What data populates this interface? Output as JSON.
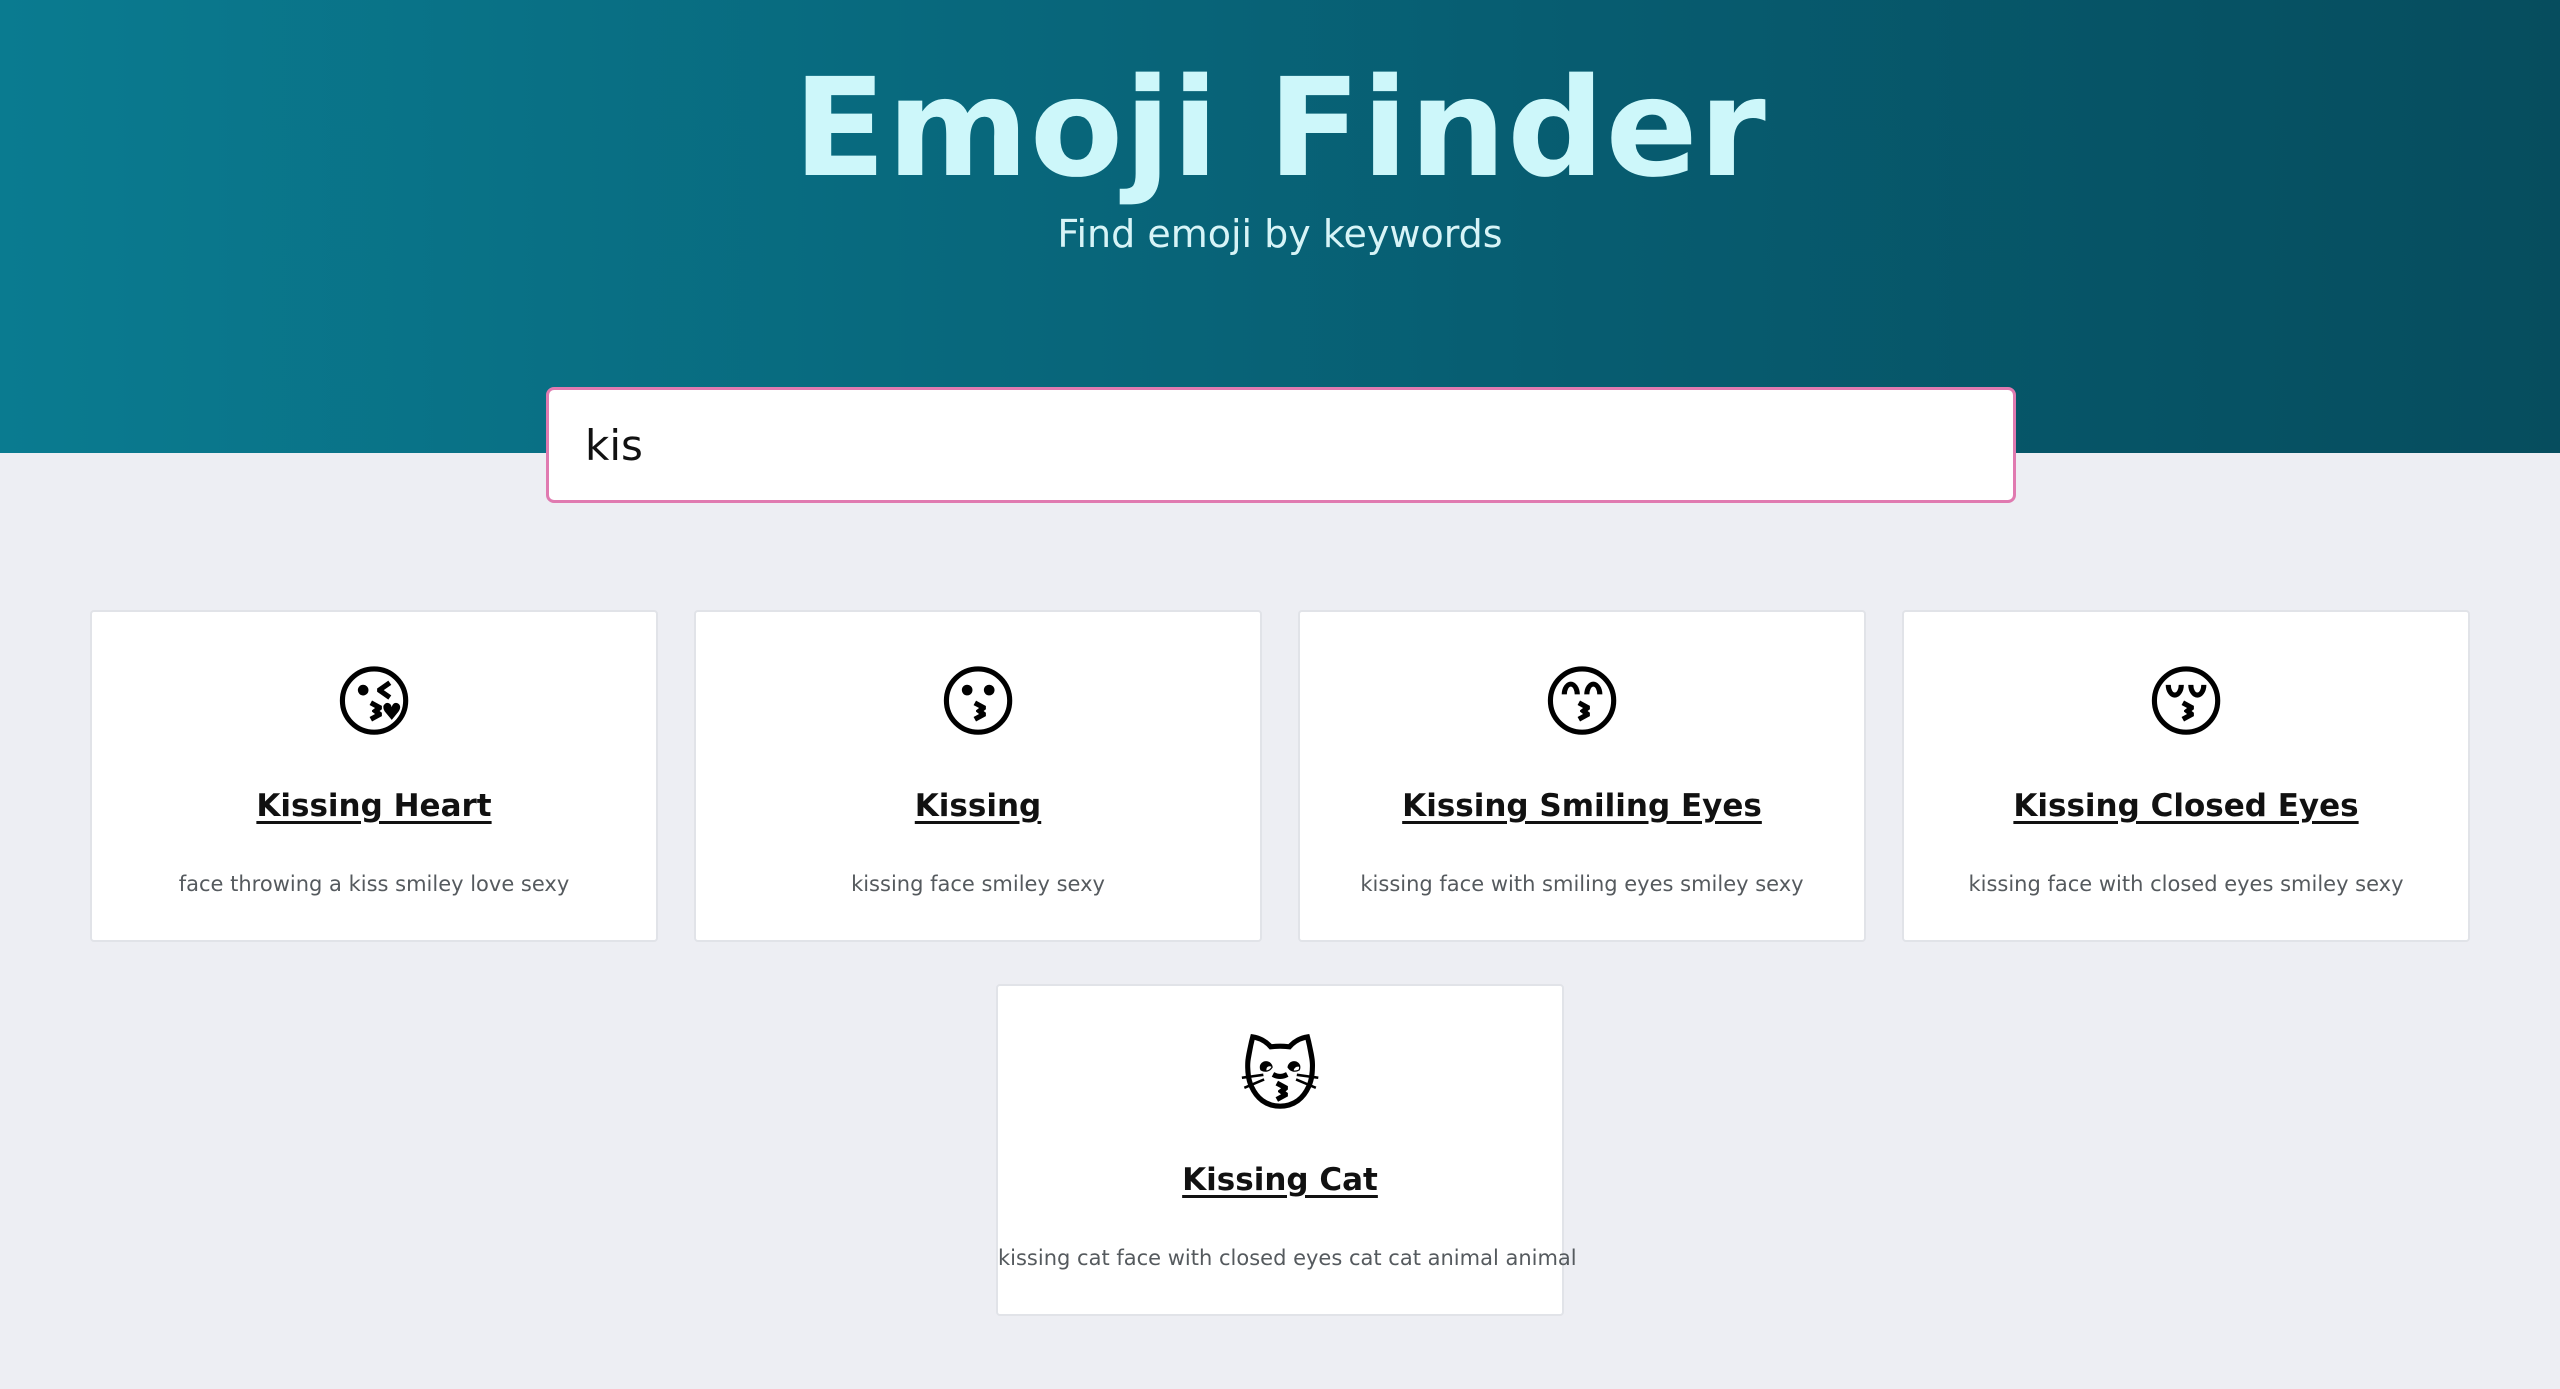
{
  "header": {
    "title": "Emoji Finder",
    "subtitle": "Find emoji by keywords"
  },
  "search": {
    "value": "kis",
    "placeholder": ""
  },
  "results": [
    {
      "emoji": "😘",
      "title": "Kissing Heart",
      "keywords": "face throwing a kiss smiley love sexy"
    },
    {
      "emoji": "😗",
      "title": "Kissing",
      "keywords": "kissing face smiley sexy"
    },
    {
      "emoji": "😙",
      "title": "Kissing Smiling Eyes",
      "keywords": "kissing face with smiling eyes smiley sexy"
    },
    {
      "emoji": "😚",
      "title": "Kissing Closed Eyes",
      "keywords": "kissing face with closed eyes smiley sexy"
    },
    {
      "emoji": "😽",
      "title": "Kissing Cat",
      "keywords": "kissing cat face with closed eyes cat cat animal animal"
    }
  ],
  "colors": {
    "header_gradient_start": "#0a7b90",
    "header_gradient_end": "#064d5e",
    "title": "#cdf7fa",
    "search_border": "#e07ab0",
    "page_background": "#edeef3"
  }
}
